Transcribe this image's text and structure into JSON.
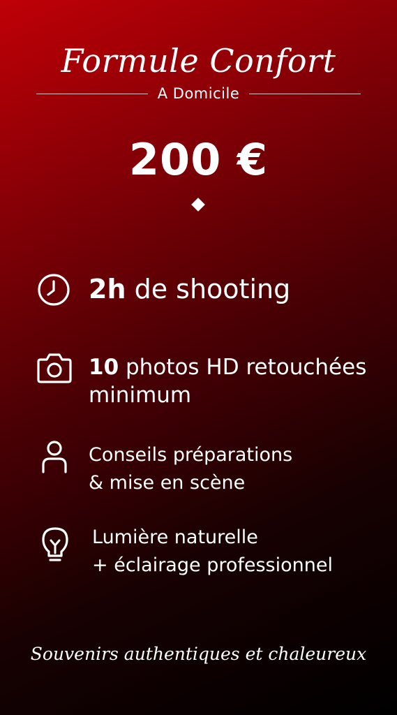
{
  "header": {
    "title": "Formule Confort",
    "subtitle": "A Domicile"
  },
  "price": "200 €",
  "features": [
    {
      "icon": "clock-icon",
      "bold": "2h",
      "text": " de shooting",
      "line2": ""
    },
    {
      "icon": "camera-icon",
      "bold": "10",
      "text": " photos HD retouchées",
      "line2": "minimum"
    },
    {
      "icon": "person-icon",
      "bold": "",
      "text": "Conseils préparations",
      "line2": "& mise en scène"
    },
    {
      "icon": "lightbulb-icon",
      "bold": "",
      "text": "Lumière naturelle",
      "line2": "+ éclairage professionnel"
    }
  ],
  "tagline": "Souvenirs authentiques et chaleureux"
}
